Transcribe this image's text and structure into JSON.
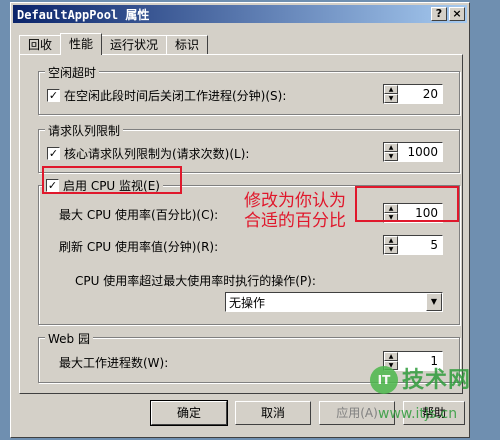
{
  "window": {
    "title": "DefaultAppPool 属性",
    "help_button": "?",
    "close_button": "×"
  },
  "tabs": [
    {
      "label": "回收"
    },
    {
      "label": "性能"
    },
    {
      "label": "运行状况"
    },
    {
      "label": "标识"
    }
  ],
  "idle": {
    "group_label": "空闲超时",
    "checkbox_label": "在空闲此段时间后关闭工作进程(分钟)(S):",
    "checked": true,
    "value": "20"
  },
  "queue": {
    "group_label": "请求队列限制",
    "checkbox_label": "核心请求队列限制为(请求次数)(L):",
    "checked": true,
    "value": "1000"
  },
  "cpu": {
    "checkbox_label": "启用 CPU 监视(E)",
    "checked": true,
    "max_label": "最大 CPU 使用率(百分比)(C):",
    "max_value": "100",
    "refresh_label": "刷新 CPU 使用率值(分钟)(R):",
    "refresh_value": "5",
    "action_label": "CPU 使用率超过最大使用率时执行的操作(P):",
    "action_value": "无操作"
  },
  "webgarden": {
    "group_label": "Web 园",
    "max_label": "最大工作进程数(W):",
    "max_value": "1"
  },
  "buttons": {
    "ok": "确定",
    "cancel": "取消",
    "apply": "应用(A)",
    "help": "帮助"
  },
  "annotation": {
    "line1": "修改为你认为",
    "line2": "合适的百分比"
  },
  "watermark": {
    "title": "技术网",
    "url": "www.itjs.cn"
  },
  "colors": {
    "annotation_red": "#e0182c",
    "titlebar": "#0a246a",
    "watermark_green": "#2f9c3c"
  }
}
